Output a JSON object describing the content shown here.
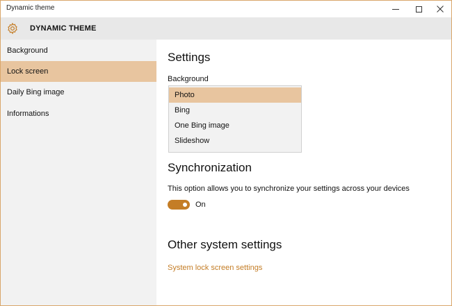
{
  "window": {
    "title": "Dynamic theme",
    "accent_color": "#c47d26",
    "selection_color": "#e8c59f"
  },
  "header": {
    "icon": "gear-icon",
    "title": "DYNAMIC THEME"
  },
  "sidebar": {
    "items": [
      {
        "label": "Background",
        "selected": false
      },
      {
        "label": "Lock screen",
        "selected": true
      },
      {
        "label": "Daily Bing image",
        "selected": false
      },
      {
        "label": "Informations",
        "selected": false
      }
    ]
  },
  "main": {
    "settings_heading": "Settings",
    "background_label": "Background",
    "background_options": [
      "Photo",
      "Bing",
      "One Bing image",
      "Slideshow"
    ],
    "background_selected": "Photo",
    "sync_heading": "Synchronization",
    "sync_description": "This option allows you to synchronize your settings across your devices",
    "sync_toggle_state": "On",
    "other_heading": "Other system settings",
    "other_link": "System lock screen settings"
  }
}
